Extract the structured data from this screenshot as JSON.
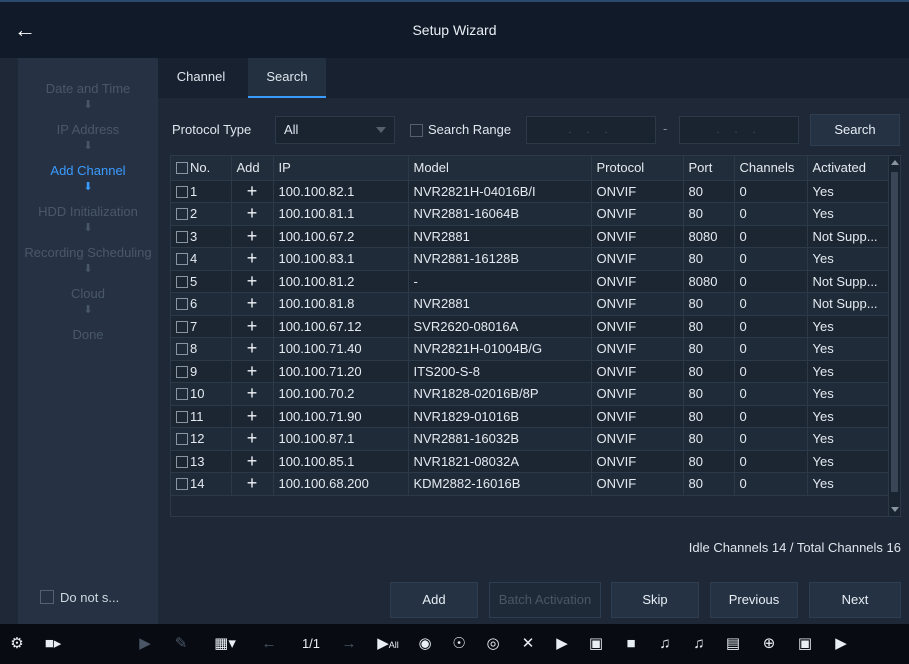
{
  "window": {
    "title": "Setup Wizard"
  },
  "sidebar": {
    "steps": [
      {
        "label": "Date and Time",
        "active": false
      },
      {
        "label": "IP Address",
        "active": false
      },
      {
        "label": "Add Channel",
        "active": true
      },
      {
        "label": "HDD Initialization",
        "active": false
      },
      {
        "label": "Recording Scheduling",
        "active": false
      },
      {
        "label": "Cloud",
        "active": false
      },
      {
        "label": "Done",
        "active": false
      }
    ],
    "do_not_show_label": "Do not s..."
  },
  "tabs": [
    {
      "label": "Channel",
      "active": false
    },
    {
      "label": "Search",
      "active": true
    }
  ],
  "filter": {
    "protocol_type_label": "Protocol Type",
    "protocol_type_value": "All",
    "search_range_label": "Search Range",
    "range_start_placeholder": ". . .",
    "range_end_placeholder": ". . .",
    "range_separator": "-",
    "search_button": "Search"
  },
  "table": {
    "columns": [
      "No.",
      "Add",
      "IP",
      "Model",
      "Protocol",
      "Port",
      "Channels",
      "Activated"
    ],
    "rows": [
      {
        "no": "1",
        "ip": "100.100.82.1",
        "model": "NVR2821H-04016B/I",
        "protocol": "ONVIF",
        "port": "80",
        "channels": "0",
        "activated": "Yes"
      },
      {
        "no": "2",
        "ip": "100.100.81.1",
        "model": "NVR2881-16064B",
        "protocol": "ONVIF",
        "port": "80",
        "channels": "0",
        "activated": "Yes"
      },
      {
        "no": "3",
        "ip": "100.100.67.2",
        "model": "NVR2881",
        "protocol": "ONVIF",
        "port": "8080",
        "channels": "0",
        "activated": "Not Supp..."
      },
      {
        "no": "4",
        "ip": "100.100.83.1",
        "model": "NVR2881-16128B",
        "protocol": "ONVIF",
        "port": "80",
        "channels": "0",
        "activated": "Yes"
      },
      {
        "no": "5",
        "ip": "100.100.81.2",
        "model": "-",
        "protocol": "ONVIF",
        "port": "8080",
        "channels": "0",
        "activated": "Not Supp..."
      },
      {
        "no": "6",
        "ip": "100.100.81.8",
        "model": "NVR2881",
        "protocol": "ONVIF",
        "port": "80",
        "channels": "0",
        "activated": "Not Supp..."
      },
      {
        "no": "7",
        "ip": "100.100.67.12",
        "model": "SVR2620-08016A",
        "protocol": "ONVIF",
        "port": "80",
        "channels": "0",
        "activated": "Yes"
      },
      {
        "no": "8",
        "ip": "100.100.71.40",
        "model": "NVR2821H-01004B/G",
        "protocol": "ONVIF",
        "port": "80",
        "channels": "0",
        "activated": "Yes"
      },
      {
        "no": "9",
        "ip": "100.100.71.20",
        "model": "ITS200-S-8",
        "protocol": "ONVIF",
        "port": "80",
        "channels": "0",
        "activated": "Yes"
      },
      {
        "no": "10",
        "ip": "100.100.70.2",
        "model": "NVR1828-02016B/8P",
        "protocol": "ONVIF",
        "port": "80",
        "channels": "0",
        "activated": "Yes"
      },
      {
        "no": "11",
        "ip": "100.100.71.90",
        "model": "NVR1829-01016B",
        "protocol": "ONVIF",
        "port": "80",
        "channels": "0",
        "activated": "Yes"
      },
      {
        "no": "12",
        "ip": "100.100.87.1",
        "model": "NVR2881-16032B",
        "protocol": "ONVIF",
        "port": "80",
        "channels": "0",
        "activated": "Yes"
      },
      {
        "no": "13",
        "ip": "100.100.85.1",
        "model": "NVR1821-08032A",
        "protocol": "ONVIF",
        "port": "80",
        "channels": "0",
        "activated": "Yes"
      },
      {
        "no": "14",
        "ip": "100.100.68.200",
        "model": "KDM2882-16016B",
        "protocol": "ONVIF",
        "port": "80",
        "channels": "0",
        "activated": "Yes"
      }
    ],
    "scrollbar": {
      "position": 0.0
    }
  },
  "summary": "Idle Channels 14 / Total Channels 16",
  "footer_buttons": {
    "add": "Add",
    "batch_activation": "Batch Activation",
    "skip": "Skip",
    "previous": "Previous",
    "next": "Next"
  },
  "bottom_toolbar": {
    "page_indicator": "1/1",
    "play_all_label": "All",
    "icons": [
      "settings-icon",
      "camera-icon",
      "play-icon",
      "edit-icon",
      "grid-layout-icon",
      "arrow-left-icon",
      "arrow-right-icon",
      "play-all-icon",
      "ptz-icon",
      "satellite-dish-icon",
      "eye-settings-icon",
      "close-icon",
      "play-icon",
      "snapshot-icon",
      "record-icon",
      "mute-icon",
      "microphone-icon",
      "subtitle-icon",
      "zoom-icon",
      "camera-settings-icon",
      "next-icon"
    ]
  },
  "colors": {
    "accent": "#3a9bff",
    "background": "#1e2836",
    "sidebar": "#263243",
    "toolbar": "#080c12"
  }
}
